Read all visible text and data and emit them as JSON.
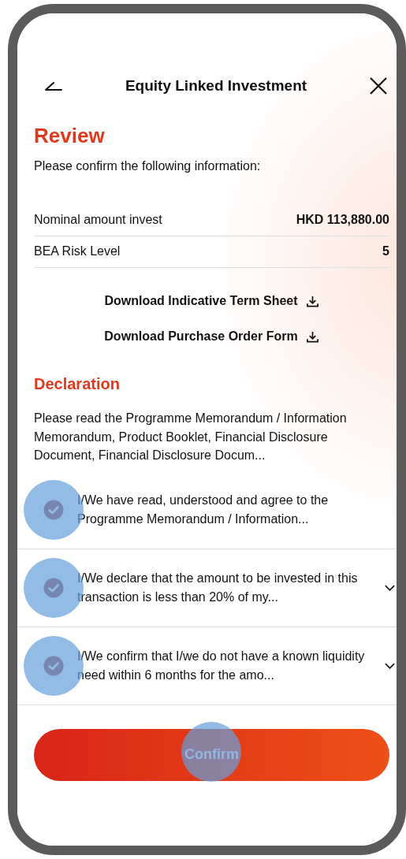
{
  "header": {
    "title": "Equity Linked Investment"
  },
  "review": {
    "heading": "Review",
    "subtitle": "Please confirm the following information:",
    "rows": [
      {
        "label": "Nominal amount invest",
        "value": "HKD 113,880.00"
      },
      {
        "label": "BEA Risk Level",
        "value": "5"
      }
    ],
    "downloads": [
      {
        "label": "Download Indicative Term Sheet"
      },
      {
        "label": "Download Purchase Order Form"
      }
    ]
  },
  "declaration": {
    "heading": "Declaration",
    "intro": "Please read the Programme Memorandum / Information Memorandum, Product Booklet, Financial Disclosure Document, Financial Disclosure Docum...",
    "items": [
      {
        "kind": "plain",
        "text": "I/We have read, understood and agree to the Programme Memorandum / Information...",
        "checked": true,
        "touched": true
      },
      {
        "kind": "expandable",
        "text": "I/We declare that the amount to be invested in this transaction is less than 20% of my...",
        "checked": true,
        "touched": true
      },
      {
        "kind": "expandable",
        "text": "I/We confirm that I/we do not have a known liquidity need within 6 months for the amo...",
        "checked": true,
        "touched": true
      }
    ]
  },
  "confirm_button": {
    "label": "Confirm",
    "touched": true
  }
}
